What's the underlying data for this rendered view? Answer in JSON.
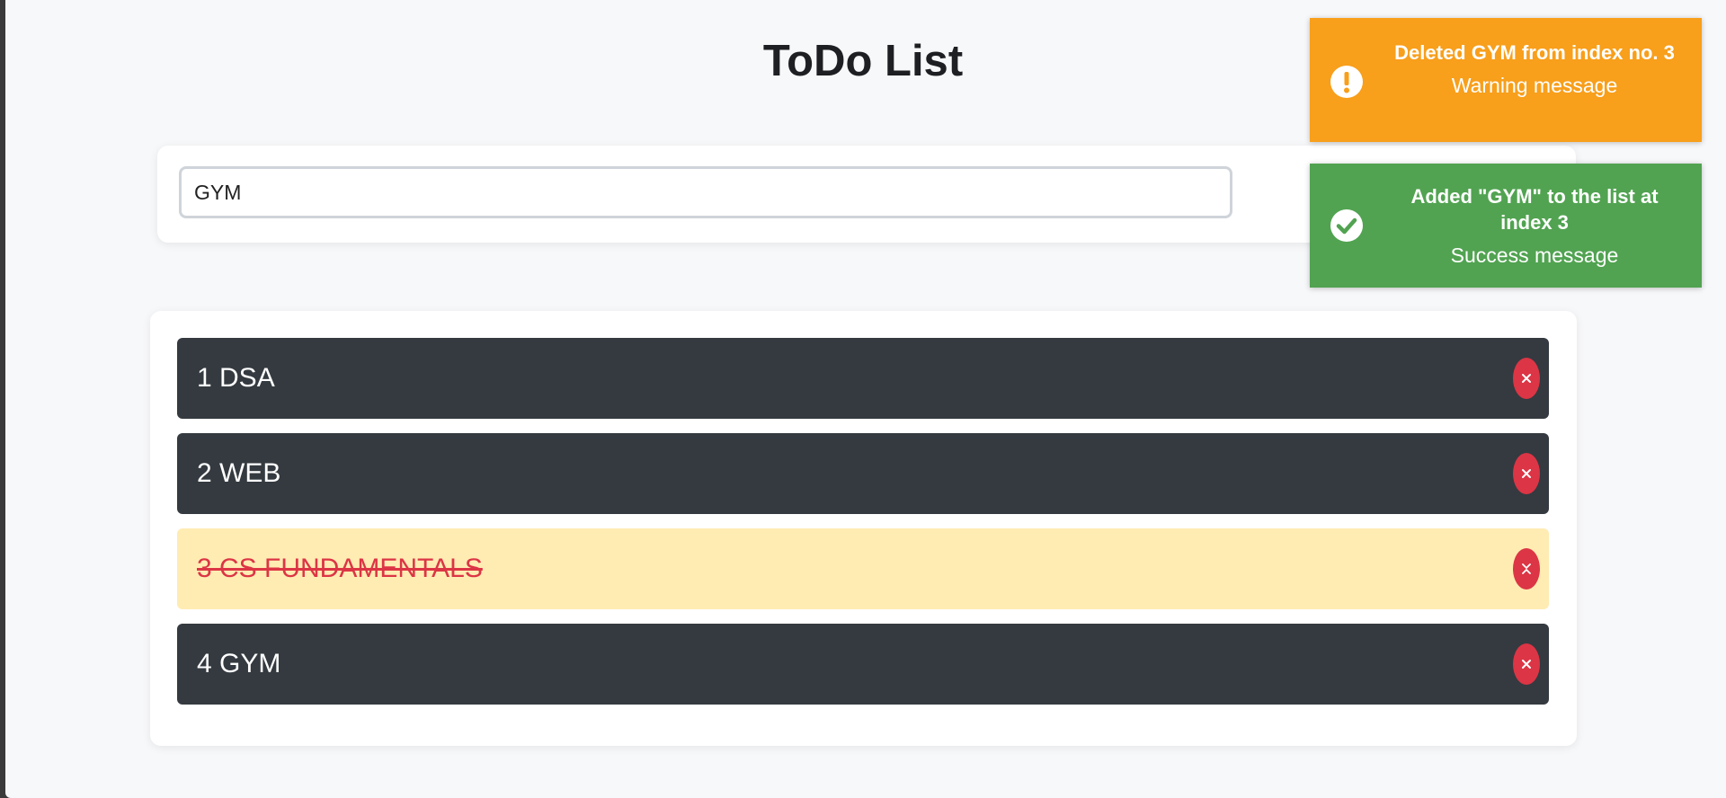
{
  "app": {
    "title": "ToDo List"
  },
  "form": {
    "input_value": "GYM"
  },
  "todos": [
    {
      "label": "1 DSA",
      "done": false
    },
    {
      "label": "2 WEB",
      "done": false
    },
    {
      "label": "3 CS FUNDAMENTALS",
      "done": true
    },
    {
      "label": "4 GYM",
      "done": false
    }
  ],
  "toasts": [
    {
      "type": "warning",
      "title": "Deleted GYM from index no. 3",
      "message": "Warning message",
      "icon": "exclamation-icon",
      "color": "#f89f1b"
    },
    {
      "type": "success",
      "title": "Added \"GYM\" to the list at index 3",
      "message": "Success message",
      "icon": "check-icon",
      "color": "#51a351"
    }
  ],
  "colors": {
    "item_bg": "#343a40",
    "item_done_bg": "#ffecb3",
    "delete": "#dc3545",
    "add": "#28a745"
  }
}
